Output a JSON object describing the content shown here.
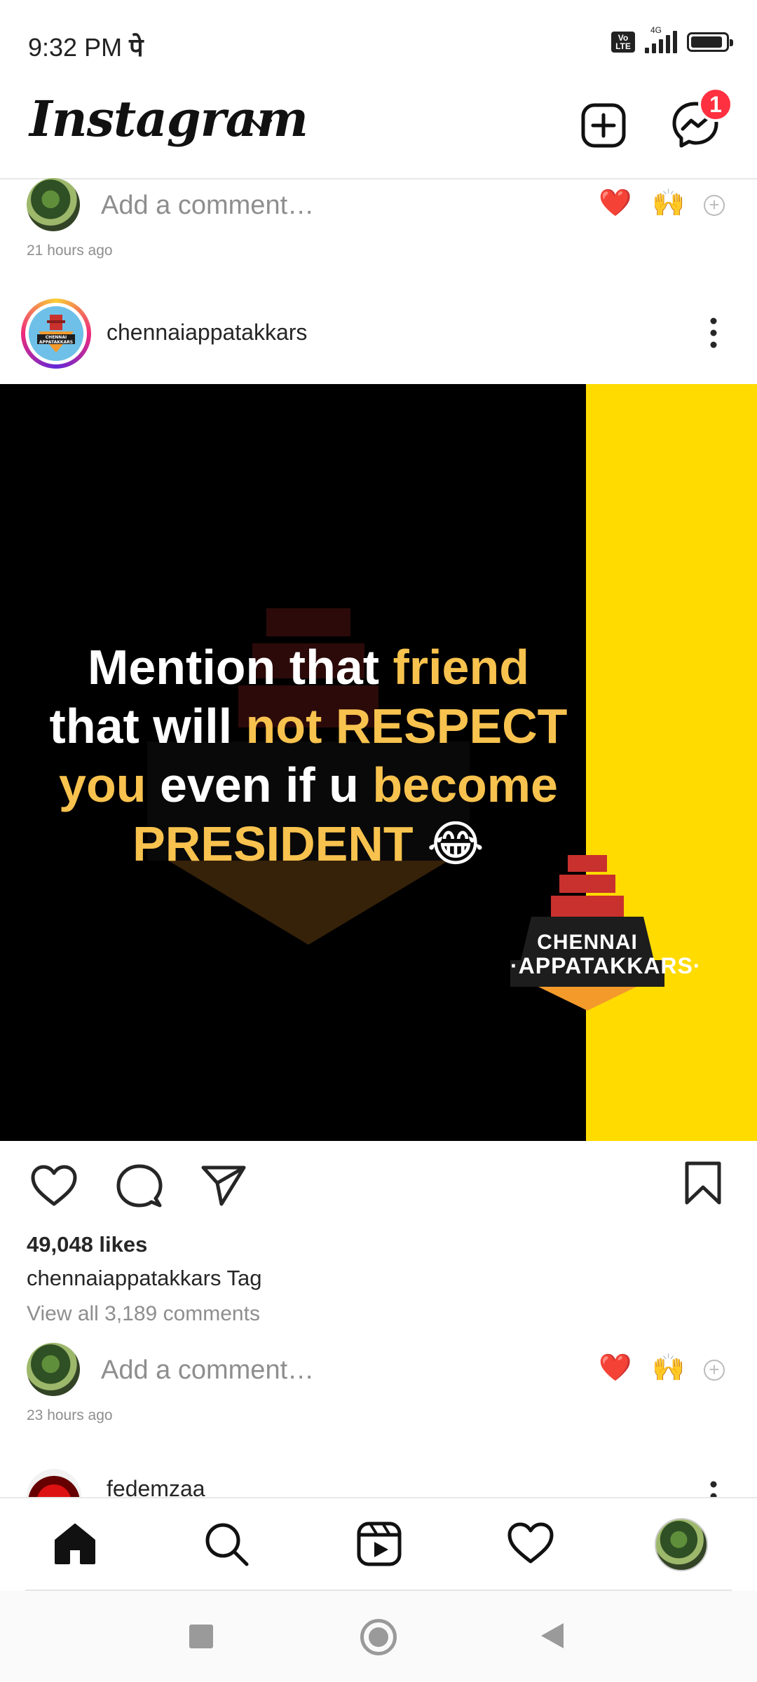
{
  "status_bar": {
    "time": "9:32 PM",
    "network_label": "4G",
    "volte_top": "Vo",
    "volte_bottom": "LTE"
  },
  "header": {
    "app_title": "Instagram",
    "messages_badge": "1"
  },
  "prev_comment": {
    "placeholder": "Add a comment…",
    "reaction_1": "❤️",
    "reaction_2": "🙌",
    "time_ago": "21 hours ago"
  },
  "post": {
    "username": "chennaiappatakkars",
    "image_text": {
      "line1_a": "Mention that ",
      "line1_b": "friend",
      "line2_a": "that will ",
      "line2_b": "not RESPECT",
      "line3_a": "you",
      "line3_b": " even if u ",
      "line3_c": "become",
      "line4_a": "PRESIDENT",
      "line4_b": " 😂"
    },
    "brand_line1": "CHENNAI",
    "brand_line2": "·APPATAKKARS·",
    "avatar_text1": "CHENNAI",
    "avatar_text2": "APPATAKKARS",
    "likes": "49,048 likes",
    "caption_user": "chennaiappatakkars",
    "caption_text": " Tag",
    "view_comments": "View all 3,189 comments",
    "comment_placeholder": "Add a comment…",
    "reaction_1": "❤️",
    "reaction_2": "🙌",
    "time_ago": "23 hours ago"
  },
  "next_post": {
    "username": "fedemzaa"
  },
  "colors": {
    "badge": "#ff3040",
    "highlight_text": "#f8c24e",
    "yellow_band": "#ffdb00"
  }
}
